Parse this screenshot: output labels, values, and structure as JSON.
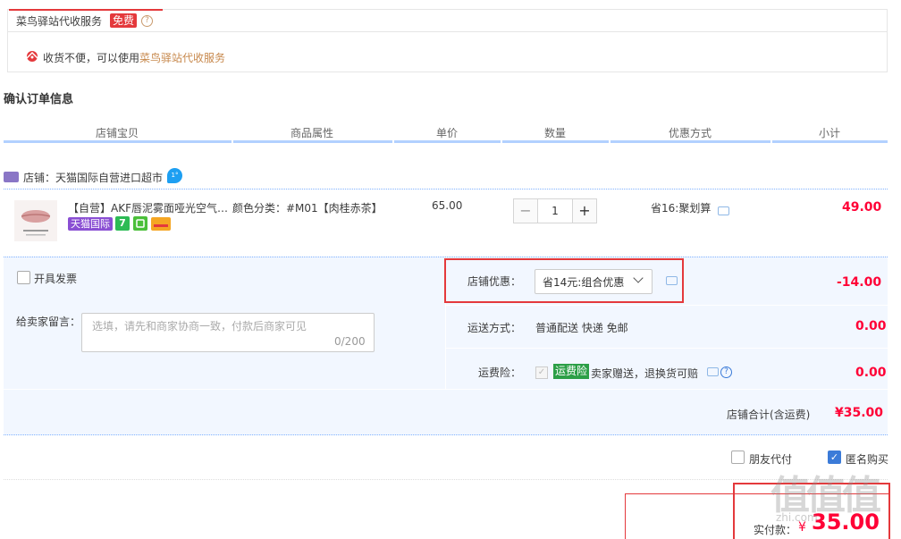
{
  "cainiao": {
    "title": "菜鸟驿站代收服务",
    "badge": "免费",
    "help": "?",
    "tip_prefix": "收货不便，可以使用",
    "tip_link": "菜鸟驿站代收服务"
  },
  "section_title": "确认订单信息",
  "columns": [
    "店铺宝贝",
    "商品属性",
    "单价",
    "数量",
    "优惠方式",
    "小计"
  ],
  "shop": {
    "name": "店铺：天猫国际自营进口超市",
    "ww": "1°"
  },
  "item": {
    "title": "【自营】AKF唇泥雾面哑光空气唇釉",
    "tag_tmall": "天猫国际",
    "tag_7": "7",
    "attr": "颜色分类：#M01【肉桂赤茶】",
    "price": "65.00",
    "qty": "1",
    "qty_minus": "−",
    "qty_plus": "+",
    "promo": "省16:聚划算",
    "subtotal": "49.00",
    "thumb_text": "#M01 肉桂赤茶"
  },
  "invoice_label": "开具发票",
  "message": {
    "label": "给卖家留言：",
    "placeholder": "选填，请先和商家协商一致，付款后商家可见",
    "count": "0/200"
  },
  "shop_discount": {
    "label": "店铺优惠：",
    "selected": "省14元:组合优惠",
    "amount": "-14.00"
  },
  "shipping": {
    "label": "运送方式：",
    "value": "普通配送 快递 免邮",
    "amount": "0.00"
  },
  "insurance": {
    "label": "运费险：",
    "badge": "运费险",
    "text": "卖家赠送，退换货可赔",
    "amount": "0.00",
    "check": "✓"
  },
  "shop_total": {
    "label": "店铺合计(含运费)",
    "value": "¥35.00"
  },
  "options": {
    "friend_pay": "朋友代付",
    "anonymous": "匿名购买",
    "check": "✓"
  },
  "pay": {
    "label": "实付款：",
    "currency": "¥",
    "value": "35.00"
  },
  "watermark": {
    "main": "值值值",
    "sub": "zhi.com"
  },
  "colors": {
    "accent_red": "#ff0036",
    "box_red": "#e4393c",
    "blue_bg": "#f2f7ff",
    "header_line": "#b2d1ff"
  }
}
